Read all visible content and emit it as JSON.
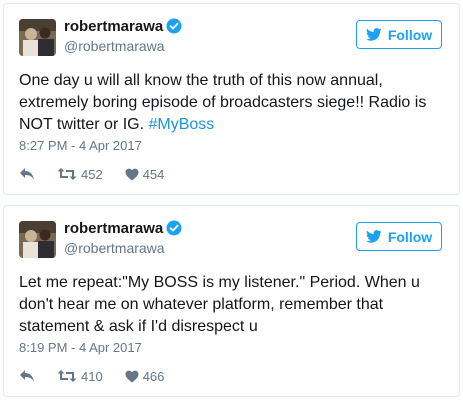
{
  "tweets": [
    {
      "user": {
        "name": "robertmarawa",
        "handle": "@robertmarawa"
      },
      "follow_label": "Follow",
      "text": "One day u will all know the truth of this now annual, extremely boring episode of broadcasters siege!! Radio is NOT twitter or IG. ",
      "hashtag": "#MyBoss",
      "timestamp": "8:27 PM - 4 Apr 2017",
      "retweets": "452",
      "likes": "454"
    },
    {
      "user": {
        "name": "robertmarawa",
        "handle": "@robertmarawa"
      },
      "follow_label": "Follow",
      "text": "Let me repeat:\"My BOSS is my listener.\" Period. When u don't hear me on whatever platform, remember that statement & ask if I'd disrespect u",
      "hashtag": "",
      "timestamp": "8:19 PM - 4 Apr 2017",
      "retweets": "410",
      "likes": "466"
    }
  ],
  "colors": {
    "accent": "#1da1f2",
    "hashtag": "#1b95e0",
    "muted": "#657786",
    "verified": "#1da1f2"
  },
  "icons": [
    "verified-badge-icon",
    "twitter-bird-icon",
    "reply-icon",
    "retweet-icon",
    "like-heart-icon"
  ]
}
